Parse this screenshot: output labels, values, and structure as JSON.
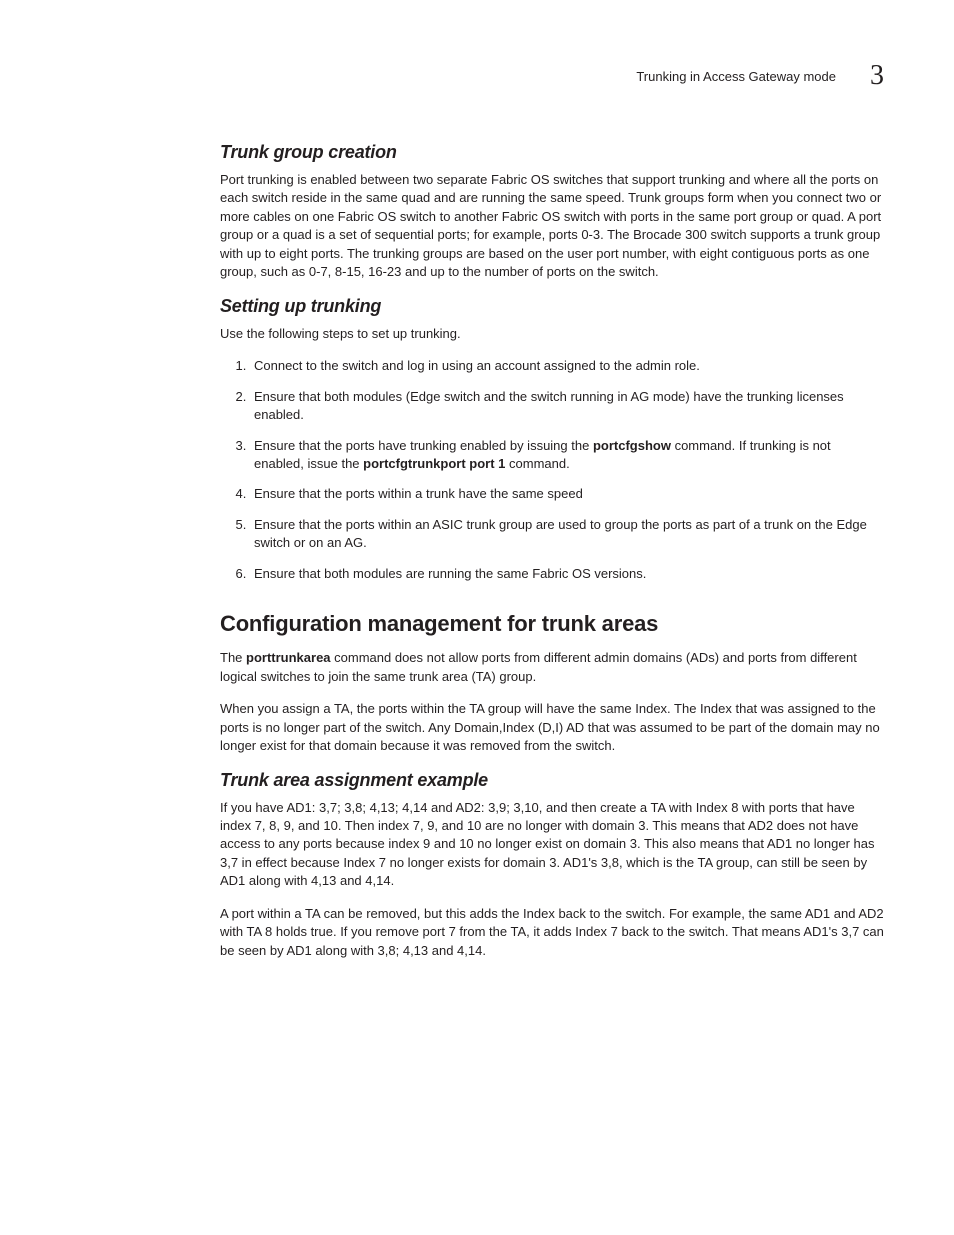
{
  "header": {
    "running_title": "Trunking in Access Gateway mode",
    "chapter_number": "3"
  },
  "sec_trunk_group": {
    "heading": "Trunk group creation",
    "p1": "Port trunking is enabled between two separate Fabric OS switches that support trunking and where all the ports on each switch reside in the same quad and are running the same speed. Trunk groups form when you connect two or more cables on one Fabric OS switch to another Fabric OS switch with ports in the same port group or quad. A port group or a quad is a set of sequential ports; for example, ports 0-3. The Brocade 300 switch supports a trunk group with up to eight ports. The trunking groups are based on the user port number, with eight contiguous ports as one group, such as 0-7, 8-15, 16-23 and up to the number of ports on the switch."
  },
  "sec_setup": {
    "heading": "Setting up trunking",
    "intro": "Use the following steps to set up trunking.",
    "steps": {
      "s1": "Connect to the switch and log in using an account assigned to the admin role.",
      "s2": "Ensure that both modules (Edge switch and the switch running in AG mode) have the trunking licenses enabled.",
      "s3_a": "Ensure that the ports have trunking enabled by issuing the ",
      "s3_cmd1": "portcfgshow",
      "s3_b": " command. If trunking is not enabled, issue the ",
      "s3_cmd2": "portcfgtrunkport port 1",
      "s3_c": " command.",
      "s4": "Ensure that the ports within a trunk have the same speed",
      "s5": "Ensure that the ports within an ASIC trunk group are used to group the ports as part of a trunk on the Edge switch or on an AG.",
      "s6": "Ensure that both modules are running the same Fabric OS versions."
    }
  },
  "sec_config_mgmt": {
    "heading": "Configuration management for trunk areas",
    "p1_a": "The ",
    "p1_cmd": "porttrunkarea",
    "p1_b": " command does not allow ports from different admin domains (ADs) and ports from different logical switches to join the same trunk area (TA) group.",
    "p2": "When you assign a TA, the ports within the TA group will have the same Index. The Index that was assigned to the ports is no longer part of the switch. Any Domain,Index (D,I) AD that was assumed to be part of the domain may no longer exist for that domain because it was removed from the switch."
  },
  "sec_ta_example": {
    "heading": "Trunk area assignment example",
    "p1": "If you have AD1: 3,7; 3,8; 4,13; 4,14 and AD2: 3,9; 3,10, and then create a TA with Index 8 with ports that have index 7, 8, 9, and 10. Then index 7, 9, and 10 are no longer with domain 3. This means that AD2 does not have access to any ports because index 9 and 10 no longer exist on domain 3. This also means that AD1 no longer has 3,7 in effect because Index 7 no longer exists for domain 3. AD1's 3,8, which is the TA group, can still be seen by AD1 along with 4,13 and 4,14.",
    "p2": "A port within a TA can be removed, but this adds the Index back to the switch. For example, the same AD1 and AD2 with TA 8 holds true. If you remove port 7 from the TA, it adds Index 7 back to the switch. That means AD1's 3,7 can be seen by AD1 along with 3,8; 4,13 and 4,14."
  }
}
